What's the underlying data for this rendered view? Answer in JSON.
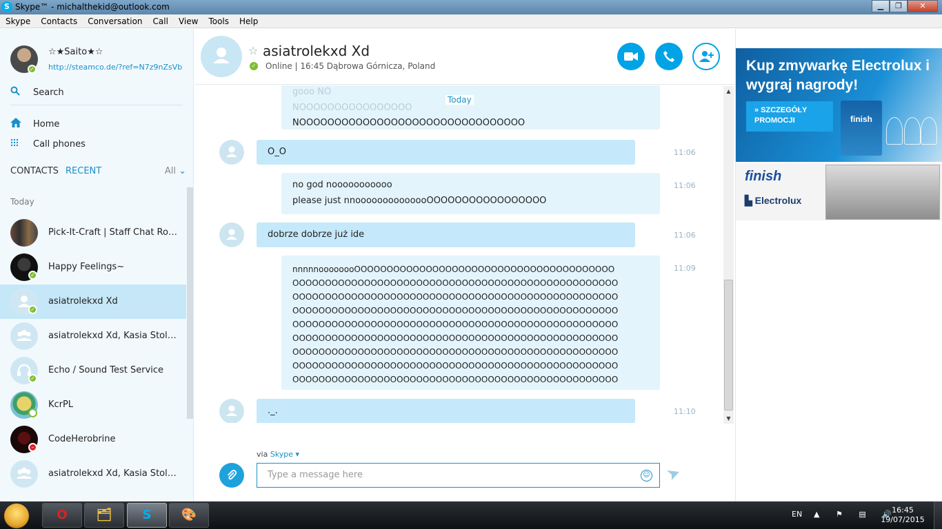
{
  "window": {
    "title": "Skype™ - michalthekid@outlook.com",
    "logo_letter": "S",
    "minimize": "▁",
    "maximize": "❐",
    "close": "✕"
  },
  "menu": [
    "Skype",
    "Contacts",
    "Conversation",
    "Call",
    "View",
    "Tools",
    "Help"
  ],
  "profile": {
    "name": "☆★Saito★☆",
    "mood": "http://steamco.de/?ref=N7z9nZsVb"
  },
  "sidebar": {
    "search_label": "Search",
    "search_icon": "search-icon",
    "home_label": "Home",
    "call_phones_label": "Call phones",
    "tab_contacts": "CONTACTS",
    "tab_recent": "RECENT",
    "filter_label": "All",
    "section_today": "Today",
    "contacts": [
      {
        "name": "Pick-It-Craft | Staff Chat Room |",
        "status": "none",
        "avatar": "group-photo"
      },
      {
        "name": "Happy Feelings~",
        "status": "online",
        "avatar": "photo"
      },
      {
        "name": "asiatrolekxd Xd",
        "status": "online",
        "avatar": "person",
        "selected": true
      },
      {
        "name": "asiatrolekxd Xd, Kasia Stolars...",
        "status": "none",
        "avatar": "group"
      },
      {
        "name": "Echo / Sound Test Service",
        "status": "online",
        "avatar": "headset"
      },
      {
        "name": "KcrPL",
        "status": "away",
        "avatar": "photo"
      },
      {
        "name": "CodeHerobrine",
        "status": "busy",
        "avatar": "photo"
      },
      {
        "name": "asiatrolekxd Xd, Kasia Stolarska",
        "status": "none",
        "avatar": "group"
      }
    ]
  },
  "conversation": {
    "name": "asiatrolekxd Xd",
    "status": "Online",
    "location": "| 16:45 Dąbrowa Górnicza, Poland",
    "date_separator": "Today",
    "faded_lines": [
      "gooo NO",
      "NOOOOOOOOOOOOOOOO"
    ],
    "messages": [
      {
        "from": "me",
        "lines": [
          "NOOOOOOOOOOOOOOOOOOOOOOOOOOOOOOOO"
        ],
        "time": ""
      },
      {
        "from": "them",
        "lines": [
          "O_O"
        ],
        "time": "11:06"
      },
      {
        "from": "me",
        "lines": [
          "no god nooooooooooo",
          "please just nnoooooooooooooOOOOOOOOOOOOOOOOO"
        ],
        "time": "11:06"
      },
      {
        "from": "them",
        "lines": [
          "dobrze dobrze już ide"
        ],
        "time": "11:06"
      },
      {
        "from": "me",
        "lines": [
          "nnnnnoooooooOOOOOOOOOOOOOOOOOOOOOOOOOOOOOOOOOOOOOOOO",
          "OOOOOOOOOOOOOOOOOOOOOOOOOOOOOOOOOOOOOOOOOOOOOOOOOO",
          "OOOOOOOOOOOOOOOOOOOOOOOOOOOOOOOOOOOOOOOOOOOOOOOOOO",
          "OOOOOOOOOOOOOOOOOOOOOOOOOOOOOOOOOOOOOOOOOOOOOOOOOO",
          "OOOOOOOOOOOOOOOOOOOOOOOOOOOOOOOOOOOOOOOOOOOOOOOOOO",
          "OOOOOOOOOOOOOOOOOOOOOOOOOOOOOOOOOOOOOOOOOOOOOOOOOO",
          "OOOOOOOOOOOOOOOOOOOOOOOOOOOOOOOOOOOOOOOOOOOOOOOOOO",
          "OOOOOOOOOOOOOOOOOOOOOOOOOOOOOOOOOOOOOOOOOOOOOOOOOO",
          "OOOOOOOOOOOOOOOOOOOOOOOOOOOOOOOOOOOOOOOOOOOOOOOOOO"
        ],
        "time": "11:09"
      },
      {
        "from": "them",
        "lines": [
          "._."
        ],
        "time": "11:10"
      }
    ],
    "via_label": "via",
    "via_link": "Skype ▾",
    "input_placeholder": "Type a message here"
  },
  "ad": {
    "headline": "Kup zmywarkę Electrolux i wygraj nagrody!",
    "cta": "» SZCZEGÓŁY PROMOCJI",
    "product_label": "finish",
    "brand_1": "finish",
    "brand_2": "Electrolux"
  },
  "taskbar": {
    "apps": [
      "O",
      "🗂",
      "S",
      "🎨"
    ],
    "language": "EN",
    "tray_icons": "▲ ⚑ ▤ 🔊",
    "time": "16:45",
    "date": "19/07/2015"
  },
  "colors": {
    "accent": "#00a3e6",
    "link": "#1a8fc9",
    "bubble_them": "#c5e9fa",
    "bubble_me": "#e3f4fc",
    "online": "#7cbf2f",
    "busy": "#e02020"
  }
}
